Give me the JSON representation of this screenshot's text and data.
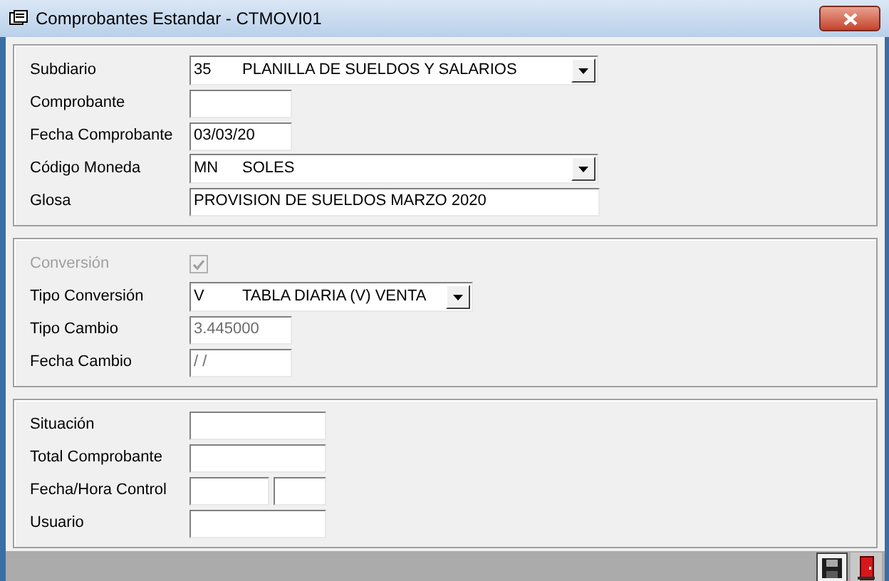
{
  "window": {
    "title": "Comprobantes Estandar - CTMOVI01"
  },
  "groups": [
    {
      "fields": [
        {
          "kind": "combo",
          "label": "Subdiario",
          "code": "35",
          "value": "PLANILLA DE SUELDOS Y SALARIOS"
        },
        {
          "kind": "text",
          "label": "Comprobante"
        },
        {
          "kind": "text",
          "label": "Fecha Comprobante",
          "value": "03/03/20"
        },
        {
          "kind": "combo",
          "label": "Código Moneda",
          "code": "MN",
          "value": "SOLES"
        },
        {
          "kind": "text",
          "label": "Glosa",
          "value": "PROVISION DE SUELDOS MARZO 2020"
        }
      ]
    },
    {
      "fields": [
        {
          "kind": "checkbox",
          "label": "Conversión",
          "checked": true,
          "disabled": true
        },
        {
          "kind": "combo",
          "label": "Tipo Conversión",
          "code": "V",
          "value": "TABLA DIARIA (V) VENTA"
        },
        {
          "kind": "text",
          "label": "Tipo Cambio",
          "value": "3.445000",
          "disabled": true
        },
        {
          "kind": "text",
          "label": "Fecha Cambio",
          "value": "/ /",
          "disabled": true
        }
      ]
    },
    {
      "fields": [
        {
          "kind": "text",
          "label": "Situación"
        },
        {
          "kind": "text",
          "label": "Total Comprobante"
        },
        {
          "kind": "pair",
          "label": "Fecha/Hora Control"
        },
        {
          "kind": "text",
          "label": "Usuario"
        }
      ]
    }
  ]
}
